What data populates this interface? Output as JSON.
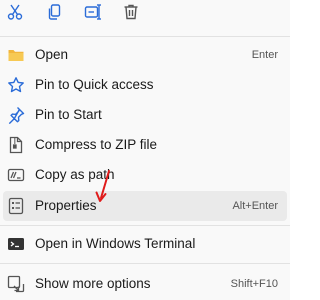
{
  "toolbar": {
    "icons": [
      "cut-icon",
      "copy-icon",
      "rename-icon",
      "delete-icon"
    ]
  },
  "menu": {
    "items": [
      {
        "label": "Open",
        "shortcut": "Enter",
        "icon": "folder-icon"
      },
      {
        "label": "Pin to Quick access",
        "shortcut": "",
        "icon": "star-icon"
      },
      {
        "label": "Pin to Start",
        "shortcut": "",
        "icon": "pin-icon"
      },
      {
        "label": "Compress to ZIP file",
        "shortcut": "",
        "icon": "zip-icon"
      },
      {
        "label": "Copy as path",
        "shortcut": "",
        "icon": "path-icon"
      },
      {
        "label": "Properties",
        "shortcut": "Alt+Enter",
        "icon": "properties-icon"
      },
      {
        "label": "Open in Windows Terminal",
        "shortcut": "",
        "icon": "terminal-icon"
      },
      {
        "label": "Show more options",
        "shortcut": "Shift+F10",
        "icon": "more-options-icon"
      }
    ]
  },
  "colors": {
    "accent": "#2b6cd8",
    "folder": "#f2b63d",
    "arrow": "#e01b1b",
    "highlight": "#eaeaea"
  }
}
